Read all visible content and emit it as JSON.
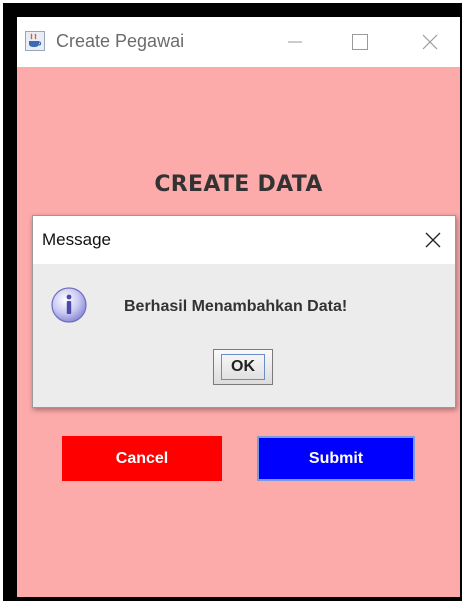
{
  "window": {
    "title": "Create Pegawai",
    "icon": "java-cup-icon"
  },
  "form": {
    "heading": "CREATE DATA",
    "cancel_label": "Cancel",
    "submit_label": "Submit"
  },
  "dialog": {
    "title": "Message",
    "message": "Berhasil Menambahkan Data!",
    "ok_label": "OK",
    "icon": "info-icon"
  },
  "colors": {
    "window_background": "#fdaaaa",
    "cancel": "#ff0000",
    "submit": "#0000ff"
  }
}
